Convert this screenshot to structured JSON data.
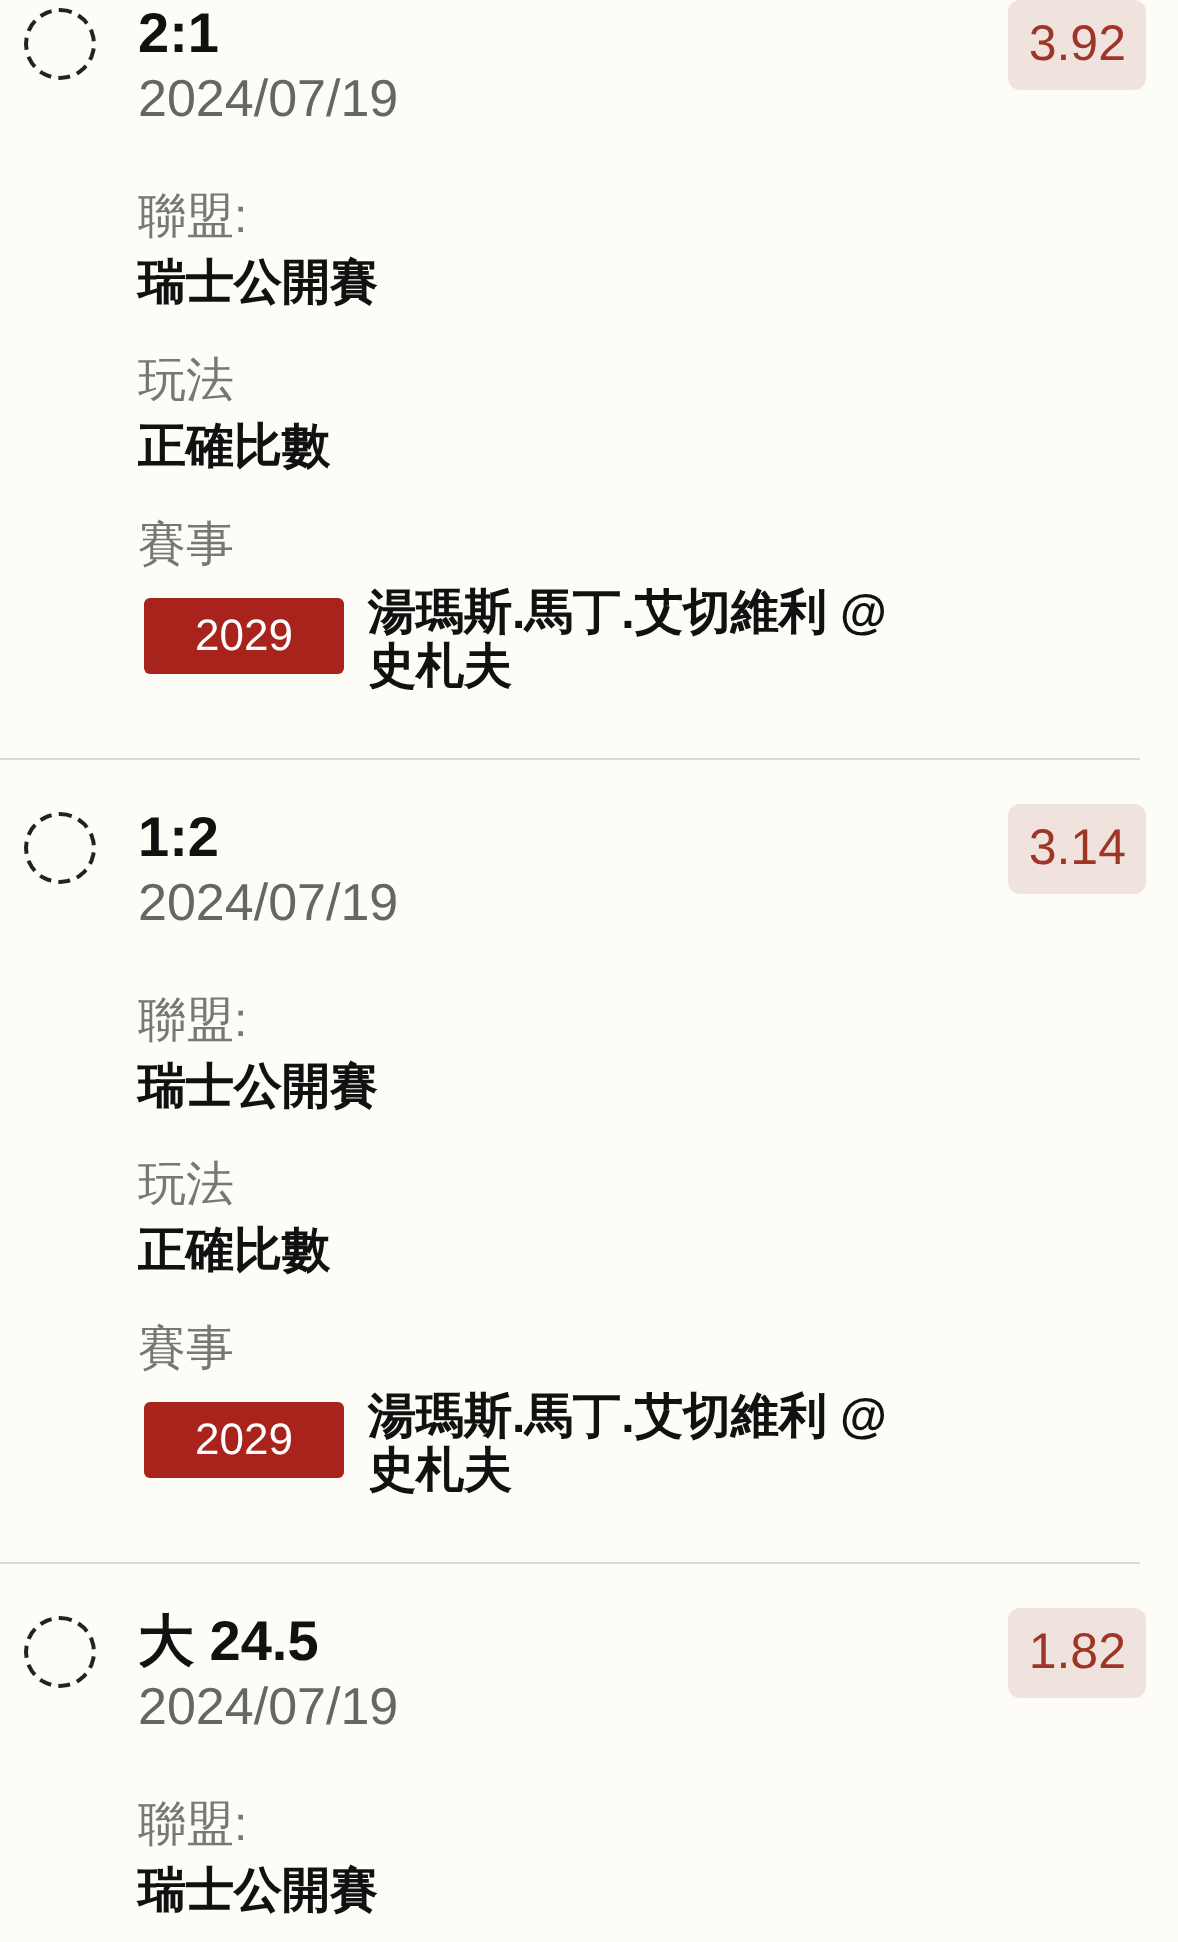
{
  "bets": [
    {
      "selected": false,
      "title": "2:1",
      "date": "2024/07/19",
      "odds": "3.92",
      "league_label": "聯盟:",
      "league": "瑞士公開賽",
      "play_label": "玩法",
      "play": "正確比數",
      "event_label": "賽事",
      "event_code": "2029",
      "event_name": "湯瑪斯.馬丁.艾切維利 @ 史札夫"
    },
    {
      "selected": false,
      "title": "1:2",
      "date": "2024/07/19",
      "odds": "3.14",
      "league_label": "聯盟:",
      "league": "瑞士公開賽",
      "play_label": "玩法",
      "play": "正確比數",
      "event_label": "賽事",
      "event_code": "2029",
      "event_name": "湯瑪斯.馬丁.艾切維利 @ 史札夫"
    },
    {
      "selected": false,
      "title": "大 24.5",
      "date": "2024/07/19",
      "odds": "1.82",
      "league_label": "聯盟:",
      "league": "瑞士公開賽"
    }
  ]
}
